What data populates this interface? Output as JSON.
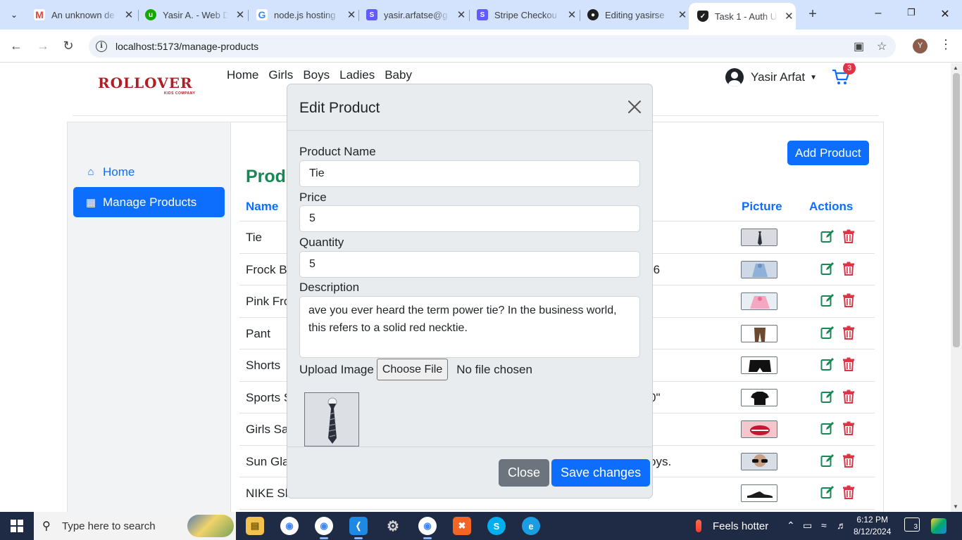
{
  "browser": {
    "tabs": [
      {
        "title": "An unknown de",
        "favicon": "gmail-icon",
        "color": "#ea4335"
      },
      {
        "title": "Yasir A. - Web D",
        "favicon": "upwork-icon",
        "color": "#14a800"
      },
      {
        "title": "node.js hosting",
        "favicon": "google-icon",
        "color": "#4285f4"
      },
      {
        "title": "yasir.arfatse@g",
        "favicon": "stripe-icon",
        "color": "#635bff"
      },
      {
        "title": "Stripe Checkou",
        "favicon": "stripe-icon",
        "color": "#635bff"
      },
      {
        "title": "Editing yasirse",
        "favicon": "github-icon",
        "color": "#1f1f1f"
      },
      {
        "title": "Task 1 - Auth U",
        "favicon": "shield-icon",
        "color": "#1f1f1f",
        "active": true
      }
    ],
    "url": "localhost:5173/manage-products",
    "profile_initial": "Y"
  },
  "site": {
    "logo": {
      "word": "ROLLOVER",
      "sub": "KIDS COMPANY"
    },
    "nav": [
      "Home",
      "Girls",
      "Boys",
      "Ladies",
      "Baby"
    ],
    "user_name": "Yasir Arfat",
    "cart_count": "3"
  },
  "sidebar": {
    "items": [
      {
        "label": "Home",
        "icon": "house-icon",
        "active": false
      },
      {
        "label": "Manage Products",
        "icon": "grid-icon",
        "active": true
      }
    ]
  },
  "content": {
    "add_button": "Add Product",
    "heading_visible": "Produ",
    "columns": {
      "name": "Name",
      "picture": "Picture",
      "actions": "Actions"
    },
    "rows": [
      {
        "name": "Tie",
        "desc_tail": "",
        "thumb": "tie"
      },
      {
        "name": "Frock Ba",
        "desc_tail": "-6",
        "thumb": "frock"
      },
      {
        "name": "Pink Fro",
        "desc_tail": "",
        "thumb": "pink"
      },
      {
        "name": "Pant",
        "desc_tail": "",
        "thumb": "pant"
      },
      {
        "name": "Shorts",
        "desc_tail": "",
        "thumb": "shorts"
      },
      {
        "name": "Sports S",
        "desc_tail": "0\"",
        "thumb": "tshirt"
      },
      {
        "name": "Girls San",
        "desc_tail": "",
        "thumb": "lips"
      },
      {
        "name": "Sun Glas",
        "desc_tail": "oys.",
        "thumb": "glasses"
      },
      {
        "name": "NIKE Sho",
        "desc_tail": "",
        "thumb": "shoe"
      }
    ]
  },
  "modal": {
    "title": "Edit Product",
    "fields": {
      "name_label": "Product Name",
      "name_value": "Tie",
      "price_label": "Price",
      "price_value": "5",
      "quantity_label": "Quantity",
      "quantity_value": "5",
      "description_label": "Description",
      "description_value": "ave you ever heard the term power tie? In the business world, this refers to a solid red necktie.",
      "upload_label": "Upload Image",
      "file_button": "Choose File",
      "file_status": "No file chosen"
    },
    "close_button": "Close",
    "save_button": "Save changes"
  },
  "taskbar": {
    "search_placeholder": "Type here to search",
    "weather": "Feels hotter",
    "time": "6:12 PM",
    "date": "8/12/2024",
    "notifications": "3"
  },
  "colors": {
    "primary": "#0d6efd",
    "success": "#198754",
    "danger": "#dc3545",
    "secondary": "#6c757d",
    "brand": "#b01e25"
  }
}
